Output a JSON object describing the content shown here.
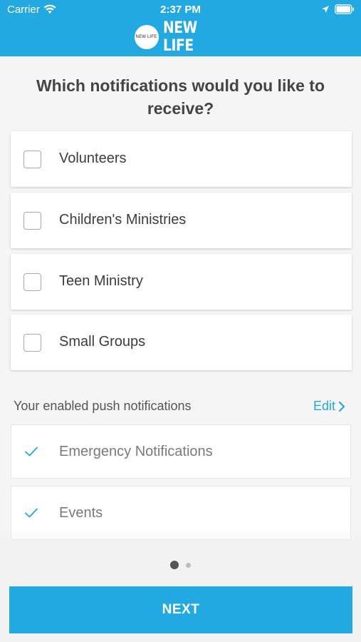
{
  "status_bar": {
    "carrier": "Carrier",
    "time": "2:37 PM"
  },
  "brand": {
    "logo_text": "NEW LIFE",
    "badge_text": "NEW LIFE",
    "accent_color": "#23a9e1"
  },
  "question": "Which notifications would you like to receive?",
  "options": [
    {
      "label": "Volunteers",
      "checked": false
    },
    {
      "label": "Children's Ministries",
      "checked": false
    },
    {
      "label": "Teen Ministry",
      "checked": false
    },
    {
      "label": "Small Groups",
      "checked": false
    }
  ],
  "enabled_section": {
    "label": "Your enabled push notifications",
    "edit_label": "Edit",
    "items": [
      {
        "label": "Emergency Notifications"
      },
      {
        "label": "Events"
      }
    ]
  },
  "pagination": {
    "current": 1,
    "total": 2
  },
  "next_button_label": "NEXT"
}
